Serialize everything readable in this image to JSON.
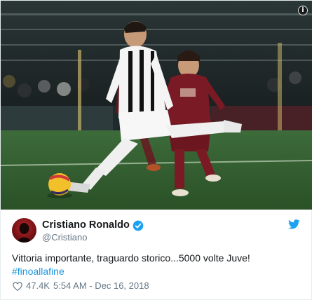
{
  "tweet": {
    "image": {
      "alt_icon": "info-icon",
      "info_glyph": "i"
    },
    "author": {
      "display_name": "Cristiano Ronaldo",
      "handle": "@Cristiano",
      "verified": true,
      "avatar_icon": "avatar-icon"
    },
    "brand_icon": "twitter-bird-icon",
    "text": "Vittoria importante, traguardo storico...5000 volte Juve!",
    "hashtag": "#finoallafine",
    "likes": "47.4K",
    "timestamp": "5:54 AM - Dec 16, 2018"
  },
  "colors": {
    "text_primary": "#14171a",
    "text_secondary": "#657786",
    "link": "#1b95e0",
    "verified": "#1da1f2",
    "twitter_blue": "#1da1f2",
    "border": "#e6ecf0"
  }
}
